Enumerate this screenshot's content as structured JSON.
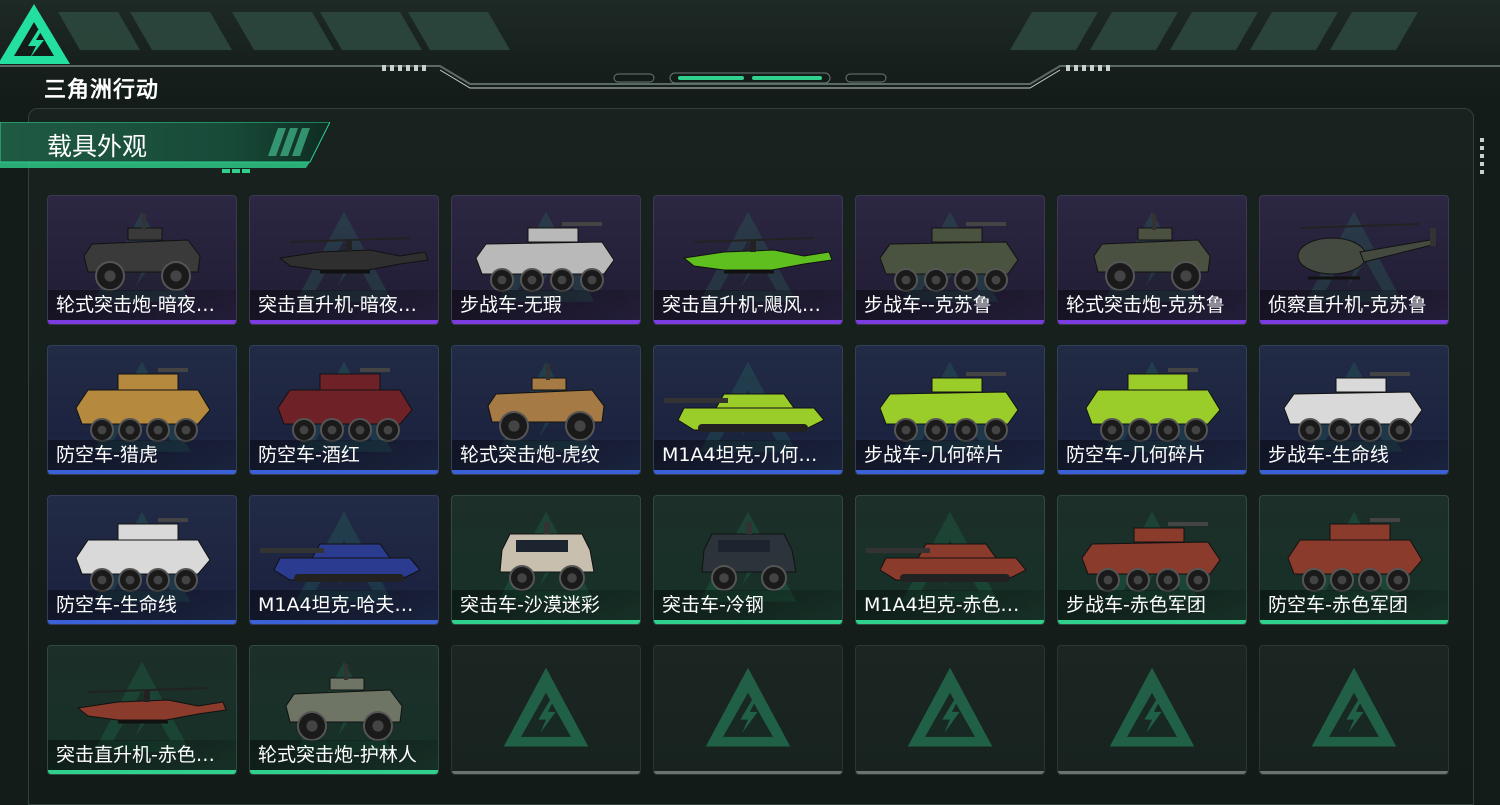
{
  "header": {
    "logo_text": "三角洲行动"
  },
  "section": {
    "title": "载具外观"
  },
  "colors": {
    "accent_green": "#2fd18d",
    "rarity_purple": "#7b3be0",
    "rarity_blue": "#3a62d6",
    "rarity_green": "#2fd18d"
  },
  "skins": [
    {
      "name": "轮式突击炮-暗夜行…",
      "rarity": "purple",
      "vehicle": "wheeled-assault-gun",
      "paint": "#3a3a3a"
    },
    {
      "name": "突击直升机-暗夜行…",
      "rarity": "purple",
      "vehicle": "attack-helicopter",
      "paint": "#2f2f2f"
    },
    {
      "name": "步战车-无瑕",
      "rarity": "purple",
      "vehicle": "ifv",
      "paint": "#b9b9b9"
    },
    {
      "name": "突击直升机-飓风行…",
      "rarity": "purple",
      "vehicle": "attack-helicopter",
      "paint": "#5fbf1e"
    },
    {
      "name": "步战车--克苏鲁",
      "rarity": "purple",
      "vehicle": "ifv",
      "paint": "#4a5240"
    },
    {
      "name": "轮式突击炮-克苏鲁",
      "rarity": "purple",
      "vehicle": "wheeled-assault-gun",
      "paint": "#4b5141"
    },
    {
      "name": "侦察直升机-克苏鲁",
      "rarity": "purple",
      "vehicle": "scout-helicopter",
      "paint": "#444a40"
    },
    {
      "name": "防空车-猎虎",
      "rarity": "blue",
      "vehicle": "aa-vehicle",
      "paint": "#b58a3e"
    },
    {
      "name": "防空车-酒红",
      "rarity": "blue",
      "vehicle": "aa-vehicle",
      "paint": "#6e2228"
    },
    {
      "name": "轮式突击炮-虎纹",
      "rarity": "blue",
      "vehicle": "wheeled-assault-gun",
      "paint": "#a67a45"
    },
    {
      "name": "M1A4坦克-几何…",
      "rarity": "blue",
      "vehicle": "tank",
      "paint": "#9acd2a"
    },
    {
      "name": "步战车-几何碎片",
      "rarity": "blue",
      "vehicle": "ifv",
      "paint": "#9acd2a"
    },
    {
      "name": "防空车-几何碎片",
      "rarity": "blue",
      "vehicle": "aa-vehicle",
      "paint": "#9acd2a"
    },
    {
      "name": "步战车-生命线",
      "rarity": "blue",
      "vehicle": "ifv",
      "paint": "#d9d9d9"
    },
    {
      "name": "防空车-生命线",
      "rarity": "blue",
      "vehicle": "aa-vehicle",
      "paint": "#d9d9d9"
    },
    {
      "name": "M1A4坦克-哈夫…",
      "rarity": "blue",
      "vehicle": "tank",
      "paint": "#2b3b8f"
    },
    {
      "name": "突击车-沙漠迷彩",
      "rarity": "green",
      "vehicle": "mrap",
      "paint": "#c9bfae"
    },
    {
      "name": "突击车-冷钢",
      "rarity": "green",
      "vehicle": "mrap",
      "paint": "#2d333b"
    },
    {
      "name": "M1A4坦克-赤色…",
      "rarity": "green",
      "vehicle": "tank",
      "paint": "#8a3b2c"
    },
    {
      "name": "步战车-赤色军团",
      "rarity": "green",
      "vehicle": "ifv",
      "paint": "#8a3b2c"
    },
    {
      "name": "防空车-赤色军团",
      "rarity": "green",
      "vehicle": "aa-vehicle",
      "paint": "#8a3b2c"
    },
    {
      "name": "突击直升机-赤色军…",
      "rarity": "green",
      "vehicle": "attack-helicopter",
      "paint": "#8a3b2c"
    },
    {
      "name": "轮式突击炮-护林人",
      "rarity": "green",
      "vehicle": "wheeled-assault-gun",
      "paint": "#6f7565"
    },
    {
      "name": "",
      "rarity": "empty",
      "vehicle": "",
      "paint": ""
    },
    {
      "name": "",
      "rarity": "empty",
      "vehicle": "",
      "paint": ""
    },
    {
      "name": "",
      "rarity": "empty",
      "vehicle": "",
      "paint": ""
    },
    {
      "name": "",
      "rarity": "empty",
      "vehicle": "",
      "paint": ""
    },
    {
      "name": "",
      "rarity": "empty",
      "vehicle": "",
      "paint": ""
    }
  ]
}
